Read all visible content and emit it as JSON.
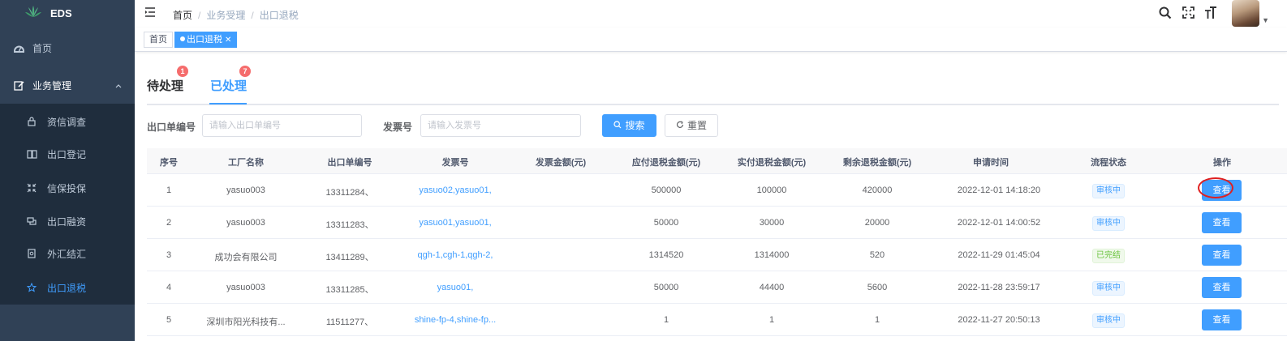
{
  "sidebar": {
    "logo": "EDS",
    "items": [
      {
        "label": "首页"
      },
      {
        "label": "业务管理"
      }
    ],
    "subitems": [
      {
        "label": "资信调查"
      },
      {
        "label": "出口登记"
      },
      {
        "label": "信保投保"
      },
      {
        "label": "出口融资"
      },
      {
        "label": "外汇结汇"
      },
      {
        "label": "出口退税"
      }
    ]
  },
  "breadcrumb": [
    "首页",
    "业务受理",
    "出口退税"
  ],
  "tags": [
    {
      "label": "首页"
    },
    {
      "label": "出口退税"
    }
  ],
  "tabs": [
    {
      "label": "待处理",
      "badge": "1"
    },
    {
      "label": "已处理",
      "badge": "7"
    }
  ],
  "search": {
    "field1_label": "出口单编号",
    "field1_placeholder": "请输入出口单编号",
    "field2_label": "发票号",
    "field2_placeholder": "请输入发票号",
    "search_label": "搜索",
    "reset_label": "重置"
  },
  "table": {
    "headers": [
      "序号",
      "工厂名称",
      "出口单编号",
      "发票号",
      "发票金额(元)",
      "应付退税金额(元)",
      "实付退税金额(元)",
      "剩余退税金额(元)",
      "申请时间",
      "流程状态",
      "操作"
    ],
    "rows": [
      {
        "no": "1",
        "factory": "yasuo003",
        "export_no": "13311284、",
        "invoice": "yasuo02,yasuo01,",
        "invoice_amount": "",
        "payable": "500000",
        "paid": "100000",
        "remaining": "420000",
        "time": "2022-12-01 14:18:20",
        "status": "审核中",
        "action": "查看"
      },
      {
        "no": "2",
        "factory": "yasuo003",
        "export_no": "13311283、",
        "invoice": "yasuo01,yasuo01,",
        "invoice_amount": "",
        "payable": "50000",
        "paid": "30000",
        "remaining": "20000",
        "time": "2022-12-01 14:00:52",
        "status": "审核中",
        "action": "查看"
      },
      {
        "no": "3",
        "factory": "成功会有限公司",
        "export_no": "13411289、",
        "invoice": "qgh-1,cgh-1,qgh-2,",
        "invoice_amount": "",
        "payable": "1314520",
        "paid": "1314000",
        "remaining": "520",
        "time": "2022-11-29 01:45:04",
        "status": "已完结",
        "action": "查看"
      },
      {
        "no": "4",
        "factory": "yasuo003",
        "export_no": "13311285、",
        "invoice": "yasuo01,",
        "invoice_amount": "",
        "payable": "50000",
        "paid": "44400",
        "remaining": "5600",
        "time": "2022-11-28 23:59:17",
        "status": "审核中",
        "action": "查看"
      },
      {
        "no": "5",
        "factory": "深圳市阳光科技有...",
        "export_no": "11511277、",
        "invoice": "shine-fp-4,shine-fp...",
        "invoice_amount": "",
        "payable": "1",
        "paid": "1",
        "remaining": "1",
        "time": "2022-11-27 20:50:13",
        "status": "审核中",
        "action": "查看"
      }
    ]
  },
  "colors": {
    "sidebar_bg": "#304156",
    "submenu_bg": "#1f2d3d",
    "accent": "#409eff",
    "badge": "#f56c6c",
    "done": "#67c23a",
    "annotation": "#e02020"
  },
  "icons": [
    "leaf-logo-icon",
    "dashboard-icon",
    "edit-icon",
    "lock-icon",
    "book-icon",
    "shrink-icon",
    "money-icon",
    "document-icon",
    "star-icon",
    "hamburger-icon",
    "search-icon",
    "fullscreen-icon",
    "font-size-icon",
    "refresh-icon",
    "close-icon",
    "chevron-up-icon"
  ]
}
